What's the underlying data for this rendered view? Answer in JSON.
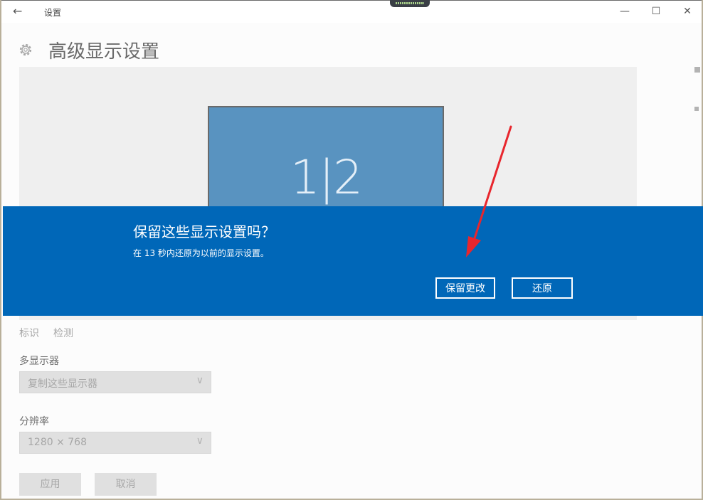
{
  "titlebar": {
    "title": "设置",
    "back_icon": "←",
    "minimize_icon": "—",
    "maximize_icon": "☐",
    "close_icon": "✕"
  },
  "page": {
    "title": "高级显示设置"
  },
  "preview": {
    "monitor_label": "1|2"
  },
  "display_links": {
    "identify": "标识",
    "detect": "检测"
  },
  "multiple_displays": {
    "label": "多显示器",
    "value": "复制这些显示器"
  },
  "resolution": {
    "label": "分辨率",
    "value": "1280 × 768"
  },
  "actions": {
    "apply": "应用",
    "cancel": "取消"
  },
  "dialog": {
    "title": "保留这些显示设置吗？",
    "message": "在 13 秒内还原为以前的显示设置。",
    "keep_label": "保留更改",
    "revert_label": "还原",
    "background_color": "#0067b8"
  },
  "colors": {
    "accent": "#0067b8",
    "monitor": "#005a9e",
    "annotation_arrow": "#e8262d"
  }
}
